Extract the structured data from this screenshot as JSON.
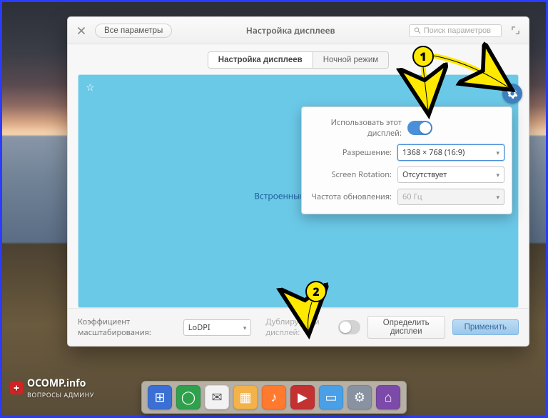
{
  "header": {
    "back_label": "Все параметры",
    "title": "Настройка дисплеев",
    "search_placeholder": "Поиск параметров"
  },
  "tabs": {
    "displays": "Настройка дисплеев",
    "night": "Ночной режим"
  },
  "canvas": {
    "builtin_label": "Встроенный дисплей"
  },
  "popover": {
    "use_display_label": "Использовать этот дисплей:",
    "resolution_label": "Разрешение:",
    "resolution_value": "1368 × 768 (16:9)",
    "rotation_label": "Screen Rotation:",
    "rotation_value": "Отсутствует",
    "refresh_label": "Частота обновления:",
    "refresh_value": "60 Гц"
  },
  "footer": {
    "scale_label": "Коэффициент масштабирования:",
    "scale_value": "LoDPI",
    "mirror_label": "Дублируемый дисплей:",
    "detect_label": "Определить дисплеи",
    "apply_label": "Применить"
  },
  "annotations": {
    "one": "1",
    "two": "2"
  },
  "watermark": {
    "brand": "OCOMP.info",
    "sub": "ВОПРОСЫ АДМИНУ"
  },
  "dock": [
    {
      "name": "multitasking-icon",
      "bg": "#3b6fd4",
      "glyph": "⊞"
    },
    {
      "name": "browser-icon",
      "bg": "#2fa14c",
      "glyph": "◯"
    },
    {
      "name": "mail-icon",
      "bg": "#f2f2f2",
      "glyph": "✉",
      "fg": "#555"
    },
    {
      "name": "calendar-icon",
      "bg": "#f4b24a",
      "glyph": "▦"
    },
    {
      "name": "music-icon",
      "bg": "#ff7a2f",
      "glyph": "♪"
    },
    {
      "name": "video-icon",
      "bg": "#c43131",
      "glyph": "▶"
    },
    {
      "name": "photos-icon",
      "bg": "#4aa0e6",
      "glyph": "▭"
    },
    {
      "name": "settings-icon",
      "bg": "#8892a0",
      "glyph": "⚙"
    },
    {
      "name": "appcenter-icon",
      "bg": "#7c4aa8",
      "glyph": "⌂"
    }
  ]
}
